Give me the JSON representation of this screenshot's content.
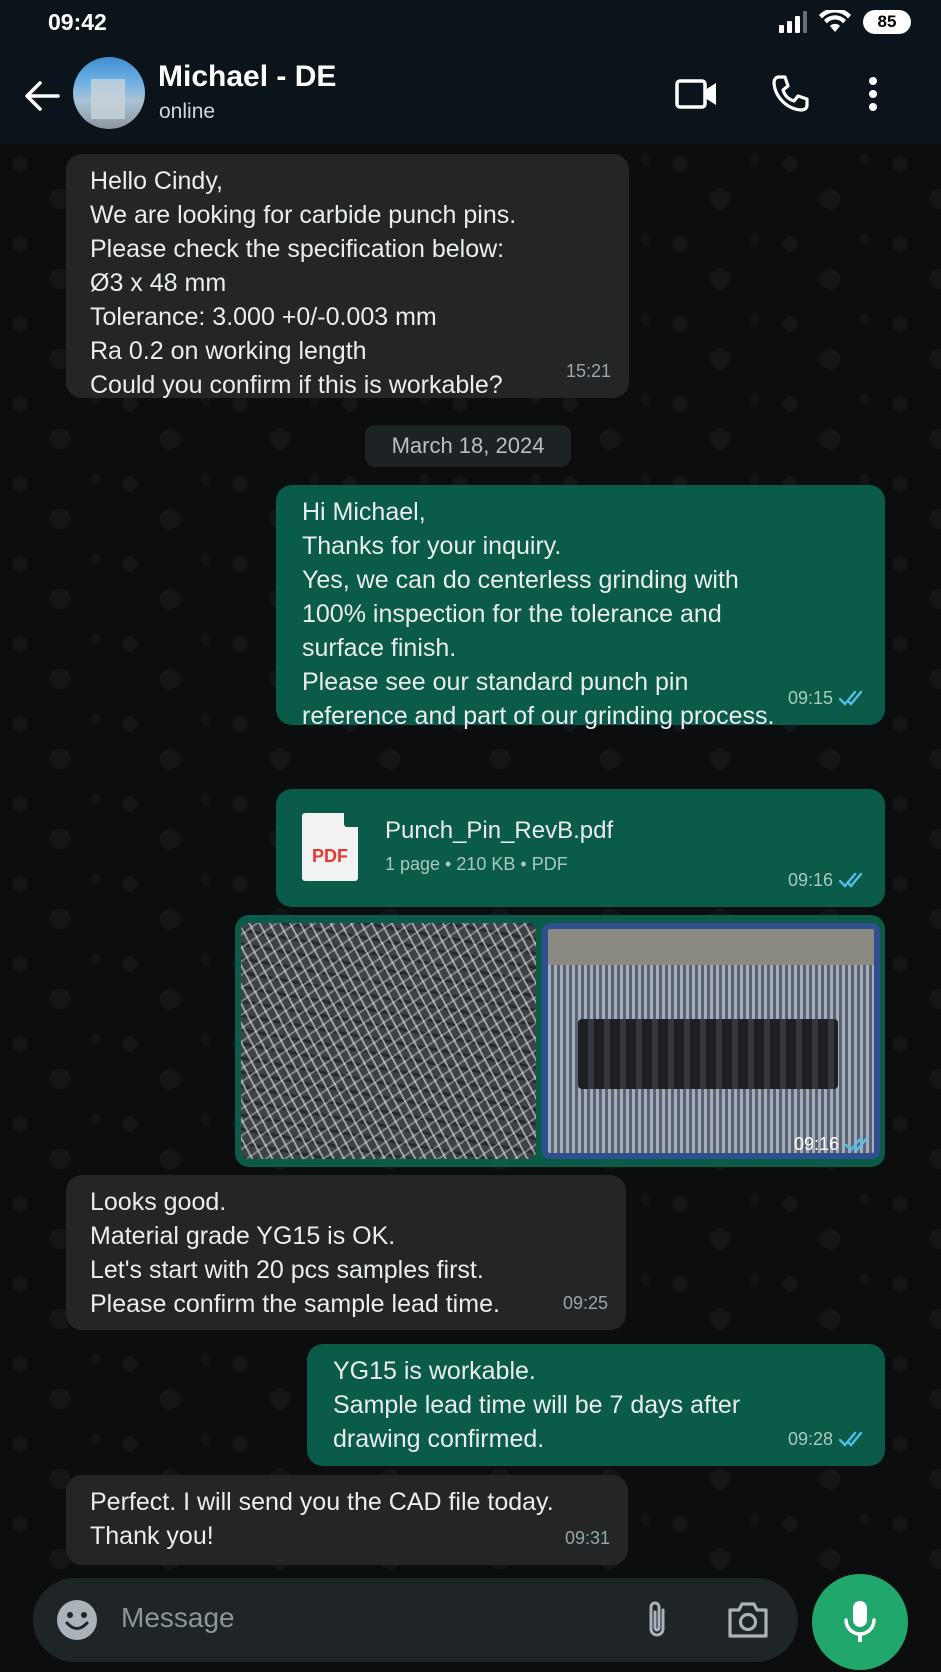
{
  "status_bar": {
    "time": "09:42",
    "battery": "85"
  },
  "header": {
    "contact_name": "Michael - DE",
    "contact_status": "online"
  },
  "messages": [
    {
      "direction": "in",
      "lines": [
        "Hello Cindy,",
        "We are looking for carbide punch pins.",
        "Please check the specification below:",
        "Ø3 x 48 mm",
        "Tolerance: 3.000 +0/-0.003 mm",
        "Ra 0.2 on working length",
        "Could you confirm if this is workable?"
      ],
      "time": "15:21"
    },
    {
      "direction": "out",
      "lines": [
        "Hi Michael,",
        "Thanks for your inquiry.",
        "Yes, we can do centerless grinding with",
        "100% inspection for the tolerance and",
        "surface finish.",
        "Please see our standard punch pin",
        "reference and part of our grinding process."
      ],
      "time": "09:15"
    },
    {
      "direction": "in",
      "lines": [
        "Looks good.",
        "Material grade YG15 is OK.",
        "Let's start with 20 pcs samples first.",
        "Please confirm the sample lead time."
      ],
      "time": "09:25"
    },
    {
      "direction": "out",
      "lines": [
        "YG15 is workable.",
        "Sample lead time will be 7 days after",
        "drawing confirmed."
      ],
      "time": "09:28"
    },
    {
      "direction": "in",
      "lines": [
        "Perfect. I will send you the CAD file today.",
        "Thank you!"
      ],
      "time": "09:31"
    }
  ],
  "date_separator": "March 18, 2024",
  "document": {
    "icon_label": "PDF",
    "name": "Punch_Pin_RevB.pdf",
    "info": "1 page • 210 KB • PDF",
    "time": "09:16"
  },
  "images_message": {
    "time": "09:16"
  },
  "input": {
    "placeholder": "Message"
  },
  "colors": {
    "incoming_bubble": "#232526",
    "outgoing_bubble": "#0a5b47",
    "read_tick": "#53bdeb",
    "mic_button": "#21a66b"
  },
  "icons": [
    "back-arrow-icon",
    "video-call-icon",
    "phone-icon",
    "more-vert-icon",
    "emoji-icon",
    "attach-icon",
    "camera-icon",
    "mic-icon",
    "double-tick-icon",
    "pdf-icon"
  ]
}
